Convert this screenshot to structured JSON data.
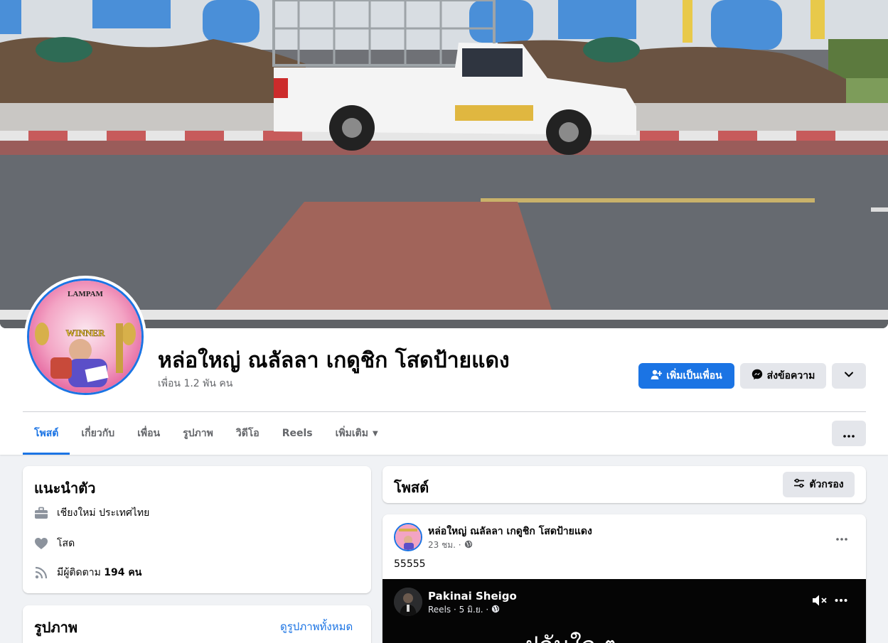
{
  "profile": {
    "name": "หล่อใหญ่ ณลัลลา เกดูชิก โสดป้ายแดง",
    "friends": "เพื่อน 1.2 พัน คน",
    "avatar_text": {
      "top": "LAMPAM",
      "bottom": "WINNER"
    }
  },
  "actions": {
    "add_friend": "เพิ่มเป็นเพื่อน",
    "message": "ส่งข้อความ"
  },
  "tabs": [
    {
      "label": "โพสต์",
      "active": true
    },
    {
      "label": "เกี่ยวกับ",
      "active": false
    },
    {
      "label": "เพื่อน",
      "active": false
    },
    {
      "label": "รูปภาพ",
      "active": false
    },
    {
      "label": "วิดีโอ",
      "active": false
    },
    {
      "label": "Reels",
      "active": false
    },
    {
      "label": "เพิ่มเติม",
      "active": false
    }
  ],
  "intro": {
    "title": "แนะนำตัว",
    "location": "เชียงใหม่ ประเทศไทย",
    "relationship": "โสด",
    "followers_prefix": "มีผู้ติดตาม ",
    "followers_count": "194 คน",
    "icons": [
      "briefcase-icon",
      "heart-icon",
      "rss-icon"
    ]
  },
  "photos": {
    "title": "รูปภาพ",
    "see_all": "ดูรูปภาพทั้งหมด"
  },
  "posts_header": {
    "title": "โพสต์",
    "filter_label": "ตัวกรอง"
  },
  "post": {
    "author": "หล่อใหญ่ ณลัลลา เกดูชิก โสดป้ายแดง",
    "time": "23 ชม. ·",
    "text": "55555"
  },
  "reel": {
    "author": "Pakinai Sheigo",
    "meta": "Reels · 5 มิ.ย. ·",
    "caption": "ฝกันใจ ๆ"
  },
  "colors": {
    "accent": "#1b74e4",
    "background": "#f0f2f5",
    "secondary_button": "#e4e6eb",
    "muted_text": "#65676b"
  }
}
